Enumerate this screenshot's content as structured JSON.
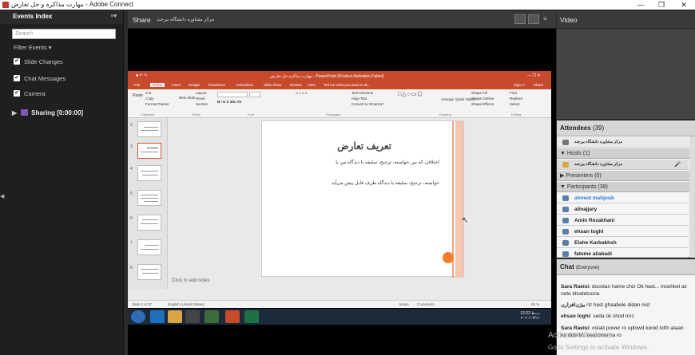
{
  "window": {
    "title": "مهارت مذاکره و حل تعارض - Adobe Connect",
    "controls": {
      "minimize": "—",
      "maximize": "❐",
      "close": "✕"
    }
  },
  "left": {
    "header": "Events Index",
    "menu_glyph": "≡▾",
    "search_placeholder": "Search",
    "filter_label": "Filter Events ▾",
    "events": [
      {
        "label": "Slide Changes",
        "checked": "✔"
      },
      {
        "label": "Chat Messages",
        "checked": "✔"
      },
      {
        "label": "Camera",
        "checked": "✔"
      }
    ],
    "sharing": "Sharing [0:00:00]"
  },
  "share": {
    "label": "Share",
    "org": "مرکز مشاوره دانشگاه بیرجند",
    "ppt": {
      "title": "مهارت مذاکره حل تعارض - PowerPoint (Product Activation Failed)",
      "sign_in": "Sign in",
      "share": "Share",
      "tabs": [
        "File",
        "Home",
        "Insert",
        "Design",
        "Transitions",
        "Animations",
        "Slide Show",
        "Review",
        "View",
        "Tell me what you want to do..."
      ],
      "groups": [
        "Clipboard",
        "Slides",
        "Font",
        "Paragraph",
        "Drawing",
        "Editing"
      ],
      "ribbon_items": {
        "paste": "Paste",
        "cut": "Cut",
        "copy": "Copy",
        "format_painter": "Format Painter",
        "new_slide": "New Slide",
        "layout": "Layout",
        "reset": "Reset",
        "section": "Section",
        "find": "Find",
        "replace": "Replace",
        "select": "Select",
        "arrange": "Arrange",
        "quick_styles": "Quick Styles",
        "shape_fill": "Shape Fill",
        "shape_outline": "Shape Outline",
        "shape_effects": "Shape Effects",
        "text_direction": "Text Direction",
        "align_text": "Align Text",
        "convert_smartart": "Convert to SmartArt"
      },
      "slide_numbers": [
        "2",
        "3",
        "4",
        "5",
        "6",
        "7",
        "8"
      ],
      "slide": {
        "heading": "تعریف تعارض",
        "line1": "اختلافی که بین خواسته، ترجیح، سلیقه یا دیدگاه من با",
        "line2": "خواسته، ترجیح، سلیقه یا دیدگاه طرف قابل پیش می‌آید"
      },
      "notes": "Click to add notes",
      "status": {
        "slide": "Slide 3 of 37",
        "lang": "English (United States)",
        "notes": "Notes",
        "comments": "Comments",
        "zoom": "66 %"
      }
    },
    "taskbar": {
      "time": "12:22 ب.ظ",
      "date": "۲۰۲۰/۰۳/۱۱"
    }
  },
  "video": {
    "label": "Video"
  },
  "attendees": {
    "label": "Attendees",
    "count": "(39)",
    "org_row": "مرکز مشاوره دانشگاه بیرجند",
    "hosts": "Hosts (1)",
    "host_name": "مرکز مشاوره دانشگاه بیرجند",
    "presenters": "Presenters (0)",
    "participants": "Participants (38)",
    "names": [
      "ahmed mahjoub",
      "alinajjary",
      "Amin Rezakhani",
      "ehsan toghi",
      "Elahe Karbakhsh",
      "fateme aliabadi"
    ]
  },
  "chat": {
    "label": "Chat",
    "sub": "(Everyone)",
    "messages": [
      {
        "name": "Sara Raeisi:",
        "text": " doostan hame chiz Ok hast... moshkel az nete khodetoone"
      },
      {
        "name": "بیژن‌افزارن",
        "text": " riz  hast  ghaabele  didan  nist"
      },
      {
        "name": "ehsan toghi:",
        "text": " seda ok shod mrc"
      },
      {
        "name": "Sara Raeisi:",
        "text": " ostad power ro uplowd konid lotfn alaan riz mibinim nevashte ha ro"
      }
    ],
    "watermark1": "Activate Windows",
    "watermark2": "Go to Settings to activate Windows."
  },
  "colors": {
    "accent": "#c84a2c",
    "participant_link": "#2b7bd6",
    "slide_dot": "#f37e2b"
  }
}
